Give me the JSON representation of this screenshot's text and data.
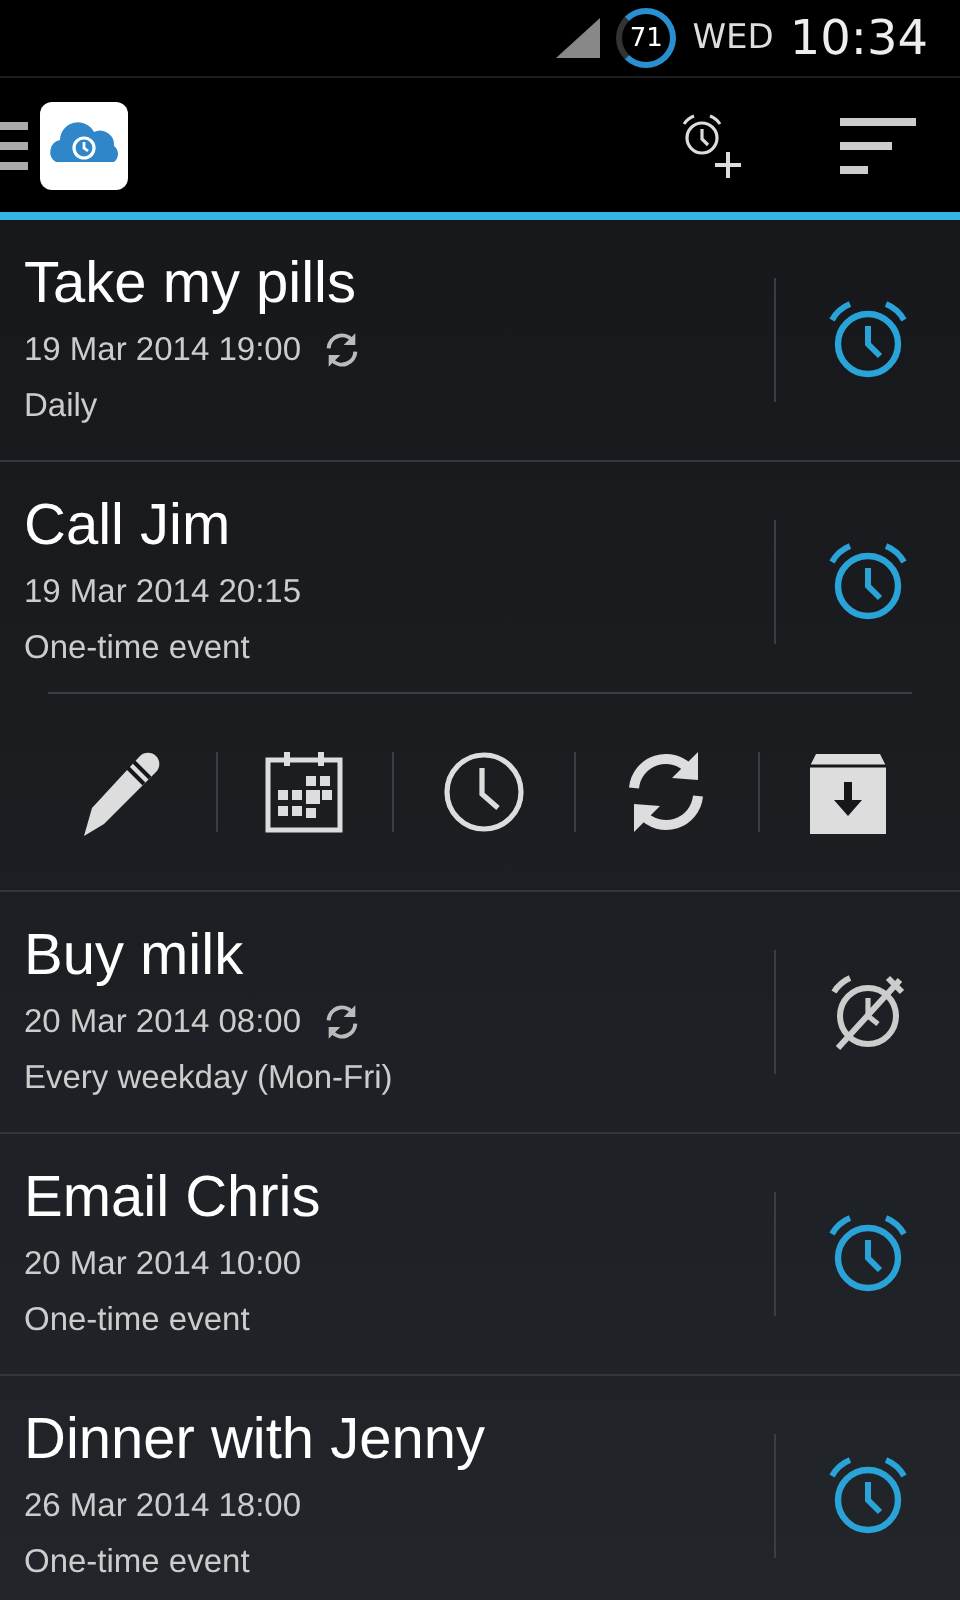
{
  "status_bar": {
    "battery": "71",
    "day": "WED",
    "time": "10:34"
  },
  "reminders": [
    {
      "title": "Take my pills",
      "datetime": "19 Mar 2014 19:00",
      "repeating": true,
      "recurrence": "Daily",
      "alarm_on": true,
      "expanded": false
    },
    {
      "title": "Call Jim",
      "datetime": "19 Mar 2014 20:15",
      "repeating": false,
      "recurrence": "One-time event",
      "alarm_on": true,
      "expanded": true
    },
    {
      "title": "Buy milk",
      "datetime": "20 Mar 2014 08:00",
      "repeating": true,
      "recurrence": "Every weekday (Mon-Fri)",
      "alarm_on": false,
      "expanded": false
    },
    {
      "title": "Email Chris",
      "datetime": "20 Mar 2014 10:00",
      "repeating": false,
      "recurrence": "One-time event",
      "alarm_on": true,
      "expanded": false
    },
    {
      "title": "Dinner with Jenny",
      "datetime": "26 Mar 2014 18:00",
      "repeating": false,
      "recurrence": "One-time event",
      "alarm_on": true,
      "expanded": false
    }
  ]
}
